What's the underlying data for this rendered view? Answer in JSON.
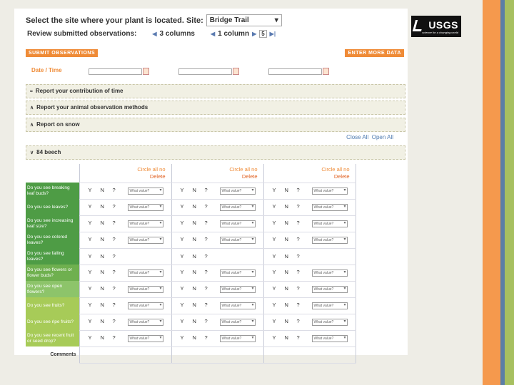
{
  "header": {
    "site_prompt": "Select the site where your plant is located.  Site:",
    "site_value": "Bridge Trail",
    "review_label": "Review submitted observations:",
    "columns_label": "3 columns",
    "column_label": "1 column",
    "page_value": "5"
  },
  "logo": {
    "text": "USGS",
    "tagline": "science for a changing world"
  },
  "buttons": {
    "submit": "SUBMIT OBSERVATIONS",
    "enter_more": "ENTER MORE DATA"
  },
  "date_label": "Date / Time",
  "sections": [
    {
      "label": "Report your contribution of time"
    },
    {
      "label": "Report your animal observation methods"
    },
    {
      "label": "Report on snow"
    }
  ],
  "links": {
    "close_all": "Close All",
    "open_all": "Open All"
  },
  "plant": {
    "label": "84 beech"
  },
  "column_header": {
    "circle": "Circle all no",
    "delete": "Delete"
  },
  "answers": {
    "yes": "Y",
    "no": "N",
    "unknown": "?",
    "select": "What value?"
  },
  "questions": [
    {
      "text": "Do you see breaking leaf buds?",
      "has_select": true
    },
    {
      "text": "Do you see leaves?",
      "has_select": true
    },
    {
      "text": "Do you see increasing leaf size?",
      "has_select": true
    },
    {
      "text": "Do you see colored leaves?",
      "has_select": true
    },
    {
      "text": "Do you see falling leaves?",
      "has_select": false
    },
    {
      "text": "Do you see flowers or flower buds?",
      "has_select": true
    },
    {
      "text": "Do you see open flowers?",
      "has_select": true
    },
    {
      "text": "Do you see fruits?",
      "has_select": true
    },
    {
      "text": "Do you see ripe fruits?",
      "has_select": true
    },
    {
      "text": "Do you see recent fruit or seed drop?",
      "has_select": true
    }
  ],
  "comments_label": "Comments"
}
